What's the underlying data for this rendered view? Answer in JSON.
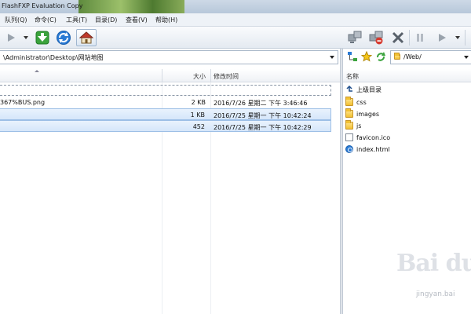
{
  "window": {
    "title": "FlashFXP Evaluation Copy"
  },
  "menu": {
    "items": [
      "队列(Q)",
      "命令(C)",
      "工具(T)",
      "目录(D)",
      "查看(V)",
      "帮助(H)"
    ]
  },
  "toolbar": {
    "left_icons": [
      "play-icon",
      "download-icon",
      "refresh-icon",
      "home-icon"
    ],
    "right_icons": [
      "connect-icon",
      "disconnect-icon",
      "abort-icon",
      "pause-icon",
      "play-icon"
    ]
  },
  "local": {
    "path": "\\Administrator\\Desktop\\网站地图",
    "columns": {
      "size": "大小",
      "modified": "修改时间"
    },
    "files": [
      {
        "name": "367%BUS.png",
        "size": "2 KB",
        "modified": "2016/7/26 星期二 下午 3:46:46",
        "selected": false
      },
      {
        "name": "",
        "size": "1 KB",
        "modified": "2016/7/25 星期一 下午 10:42:24",
        "selected": true
      },
      {
        "name": "",
        "size": "452",
        "modified": "2016/7/25 星期一 下午 10:42:29",
        "selected": true
      }
    ]
  },
  "remote": {
    "path": "/Web/",
    "columns": {
      "name": "名称"
    },
    "parent_label": "上级目录",
    "items": [
      {
        "name": "css",
        "type": "folder"
      },
      {
        "name": "images",
        "type": "folder"
      },
      {
        "name": "js",
        "type": "folder"
      },
      {
        "name": "favicon.ico",
        "type": "file"
      },
      {
        "name": "index.html",
        "type": "html"
      }
    ]
  },
  "watermark": {
    "brand": "Bai du",
    "url": "jingyan.bai"
  },
  "colors": {
    "selection": "#d5e6fa",
    "selection_border": "#9dbfe6",
    "folder": "#f2c132",
    "accent_green": "#3aa33c",
    "accent_blue": "#2a7ad4"
  }
}
